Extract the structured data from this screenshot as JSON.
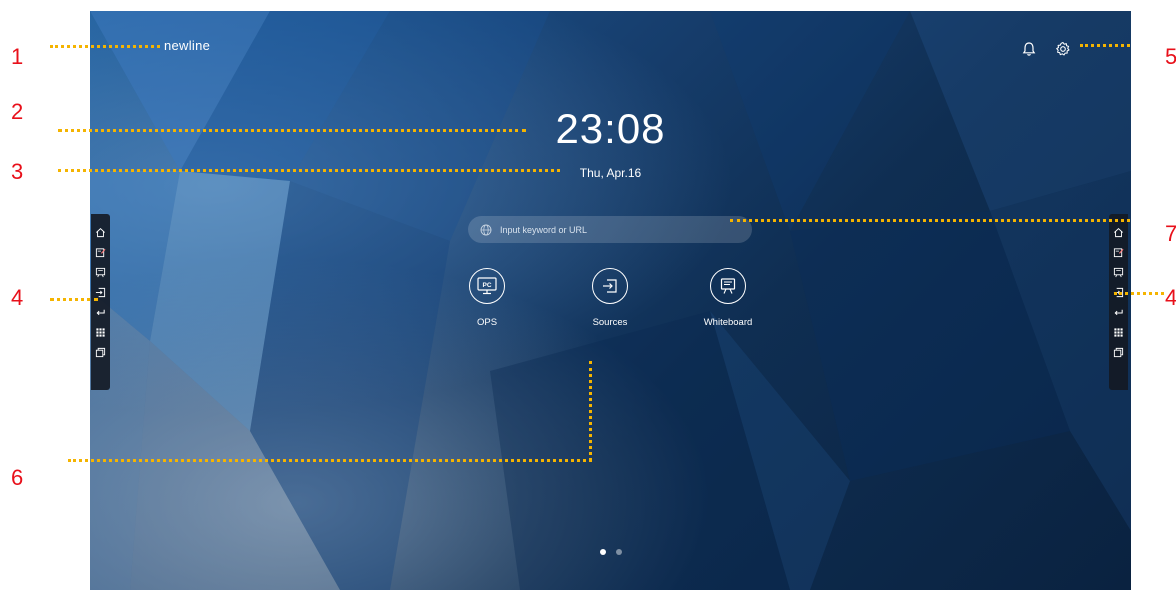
{
  "callouts": [
    "1",
    "2",
    "3",
    "4",
    "4",
    "5",
    "6",
    "7"
  ],
  "brand": "newline",
  "clock": "23:08",
  "date": "Thu, Apr.16",
  "search": {
    "placeholder": "Input keyword or URL"
  },
  "apps": [
    {
      "label": "OPS",
      "icon": "pc-icon",
      "glyph": "PC"
    },
    {
      "label": "Sources",
      "icon": "input-source-icon"
    },
    {
      "label": "Whiteboard",
      "icon": "whiteboard-icon"
    }
  ],
  "sidebar_items": [
    "home-icon",
    "annotate-icon",
    "whiteboard-icon",
    "source-icon",
    "back-icon",
    "apps-grid-icon",
    "windows-icon"
  ],
  "top_icons": [
    "bell-icon",
    "gear-icon"
  ],
  "pager": {
    "pages": 2,
    "active": 0
  },
  "colors": {
    "callout": "#e8101a",
    "leader": "#f5b400",
    "sidebar": "#14192299"
  }
}
